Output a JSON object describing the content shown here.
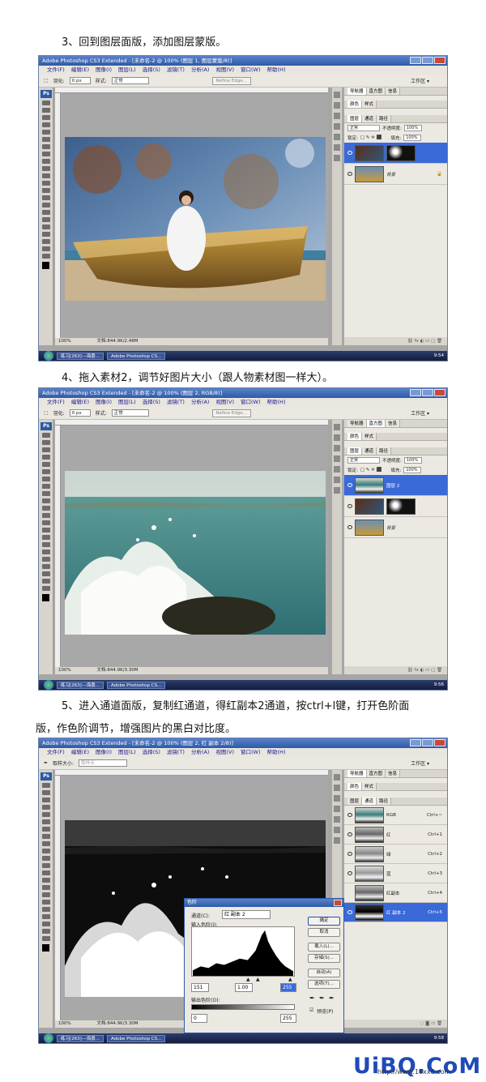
{
  "steps": {
    "s3": "3、回到图层面版，添加图层蒙版。",
    "s4": "4、拖入素材2，调节好图片大小（跟人物素材图一样大）。",
    "s5_line1": "5、进入通道面版，复制红通道，得红副本2通道，按ctrl+l键，打开色阶面",
    "s5_line2": "版，作色阶调节，增强图片的黑白对比度。"
  },
  "screens": [
    {
      "title": "Adobe Photoshop CS3 Extended - [未命名-2 @ 100% (图层 1, 图层蒙版/8)]",
      "menus": [
        "文件(F)",
        "编辑(E)",
        "图像(I)",
        "图层(L)",
        "选择(S)",
        "滤镜(T)",
        "分析(A)",
        "视图(V)",
        "窗口(W)",
        "帮助(H)"
      ],
      "workspace": "工作区 ▾",
      "feather_label": "羽化:",
      "feather_value": "0 px",
      "style_label": "样式:",
      "style_value": "正常",
      "refine": "Refine Edge...",
      "status_zoom": "100%",
      "status_doc": "文档:844.9K/2.48M",
      "panel_tabs_top": [
        "导航器",
        "直方图",
        "信息"
      ],
      "panel_tabs_mid": [
        "颜色",
        "样式"
      ],
      "panel_tabs_layers": [
        "图层",
        "通道",
        "路径"
      ],
      "blend": "正常",
      "opacity_label": "不透明度:",
      "opacity": "100%",
      "lock_label": "锁定:",
      "fill_label": "填充:",
      "fill": "100%",
      "layers": [
        {
          "name": "",
          "selected": true,
          "mask": true
        },
        {
          "name": "背景",
          "selected": false,
          "mask": false
        }
      ],
      "task1": "练习[263]---海景...",
      "task2": "Adobe Photoshop CS...",
      "clock": "9:54"
    },
    {
      "title": "Adobe Photoshop CS3 Extended - [未命名-2 @ 100% (图层 2, RGB/8)]",
      "menus": [
        "文件(F)",
        "编辑(E)",
        "图像(I)",
        "图层(L)",
        "选择(S)",
        "滤镜(T)",
        "分析(A)",
        "视图(V)",
        "窗口(W)",
        "帮助(H)"
      ],
      "workspace": "工作区 ▾",
      "feather_label": "羽化:",
      "feather_value": "0 px",
      "style_label": "样式:",
      "style_value": "正常",
      "refine": "Refine Edge...",
      "status_zoom": "100%",
      "status_doc": "文档:844.9K/3.30M",
      "panel_tabs_top": [
        "导航器",
        "直方图",
        "信息"
      ],
      "panel_tabs_mid": [
        "颜色",
        "样式"
      ],
      "panel_tabs_layers": [
        "图层",
        "通道",
        "路径"
      ],
      "blend": "正常",
      "opacity_label": "不透明度:",
      "opacity": "100%",
      "lock_label": "锁定:",
      "fill_label": "填充:",
      "fill": "100%",
      "layers": [
        {
          "name": "图层 2",
          "selected": true,
          "mask": false
        },
        {
          "name": "",
          "selected": false,
          "mask": true
        },
        {
          "name": "背景",
          "selected": false,
          "mask": false
        }
      ],
      "task1": "练习[263]---海景...",
      "task2": "Adobe Photoshop CS...",
      "clock": "9:56"
    },
    {
      "title": "Adobe Photoshop CS3 Extended - [未命名-2 @ 100% (图层 2, 红 副本 2/8)]",
      "menus": [
        "文件(F)",
        "编辑(E)",
        "图像(I)",
        "图层(L)",
        "选择(S)",
        "滤镜(T)",
        "分析(A)",
        "视图(V)",
        "窗口(W)",
        "帮助(H)"
      ],
      "workspace": "工作区 ▾",
      "sample_label": "取样大小:",
      "sample_value": "取样点",
      "status_zoom": "100%",
      "status_doc": "文档:844.9K/3.30M",
      "panel_tabs_top": [
        "导航器",
        "直方图",
        "信息"
      ],
      "panel_tabs_mid": [
        "颜色",
        "样式"
      ],
      "panel_tabs_layers": [
        "图层",
        "通道",
        "路径"
      ],
      "channels": [
        {
          "name": "RGB",
          "key": "Ctrl+~"
        },
        {
          "name": "红",
          "key": "Ctrl+1"
        },
        {
          "name": "绿",
          "key": "Ctrl+2"
        },
        {
          "name": "蓝",
          "key": "Ctrl+3"
        },
        {
          "name": "红副本",
          "key": "Ctrl+4"
        },
        {
          "name": "红 副本 2",
          "key": "Ctrl+5"
        }
      ],
      "task1": "练习[263]---海景...",
      "task2": "Adobe Photoshop CS...",
      "clock": "9:58"
    }
  ],
  "levels_dialog": {
    "title": "色阶",
    "channel_label": "通道(C):",
    "channel_value": "红 副本 2",
    "input_label": "输入色阶(I):",
    "input_black": "151",
    "input_gamma": "1.00",
    "input_white": "255",
    "output_label": "输出色阶(O):",
    "output_black": "0",
    "output_white": "255",
    "buttons": [
      "确定",
      "取消",
      "载入(L)...",
      "存储(S)...",
      "自动(A)",
      "选项(T)..."
    ],
    "preview_label": "预览(P)"
  },
  "footer": {
    "logo": "UiBQ.CoM",
    "url": "http://www.16xx8.com"
  }
}
